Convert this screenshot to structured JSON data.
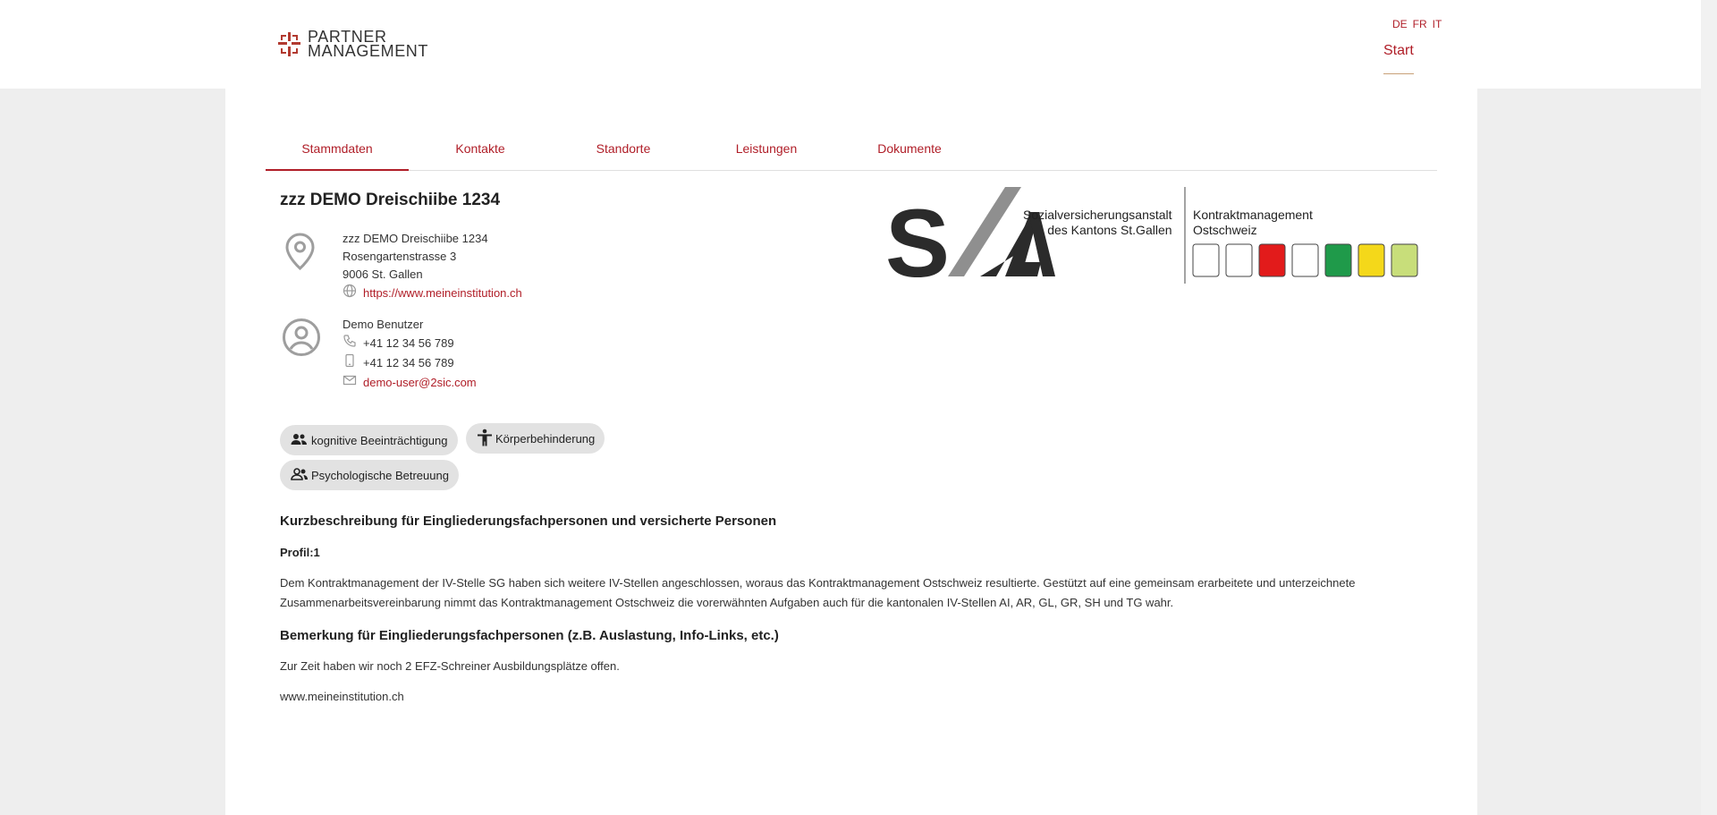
{
  "brand": {
    "line1": "PARTNER",
    "line2": "MANAGEMENT"
  },
  "languages": [
    "DE",
    "FR",
    "IT"
  ],
  "nav": {
    "start": "Start"
  },
  "tabs": [
    "Stammdaten",
    "Kontakte",
    "Standorte",
    "Leistungen",
    "Dokumente"
  ],
  "institution": {
    "name": "zzz DEMO Dreischiibe 1234",
    "address_name": "zzz DEMO Dreischiibe 1234",
    "street": "Rosengartenstrasse 3",
    "city": "9006 St. Gallen",
    "website": "https://www.meineinstitution.ch"
  },
  "contact": {
    "name": "Demo Benutzer",
    "phone": "+41 12 34 56 789",
    "mobile": "+41 12 34 56 789",
    "email": "demo-user@2sic.com"
  },
  "chips": [
    "kognitive Beeinträchtigung",
    "Körperbehinderung",
    "Psychologische Betreuung"
  ],
  "logo": {
    "sva_line1": "Sozialversicherungsanstalt",
    "sva_line2": "des Kantons St.Gallen",
    "km_line1": "Kontraktmanagement",
    "km_line2": "Ostschweiz"
  },
  "description": {
    "heading": "Kurzbeschreibung für Eingliederungsfachpersonen und versicherte Personen",
    "profil": "Profil:1",
    "text": "Dem Kontraktmanagement der IV-Stelle SG haben sich weitere IV-Stellen angeschlossen, woraus das Kontraktmanagement Ostschweiz resultierte. Gestützt auf eine gemeinsam erarbeitete und unterzeichnete Zusammenarbeitsvereinbarung nimmt das Kontraktmanagement Ostschweiz die vorerwähnten Aufgaben auch für die kantonalen IV-Stellen AI, AR, GL, GR, SH und TG wahr."
  },
  "remarks": {
    "heading": "Bemerkung für Eingliederungsfachpersonen (z.B. Auslastung, Info-Links, etc.)",
    "text": "Zur Zeit haben wir noch 2 EFZ-Schreiner Ausbildungsplätze offen.",
    "link": "www.meineinstitution.ch"
  },
  "colors": {
    "accent": "#b01e28",
    "brand_mark": "#b23a30",
    "chip_bg": "#e2e2e2"
  }
}
